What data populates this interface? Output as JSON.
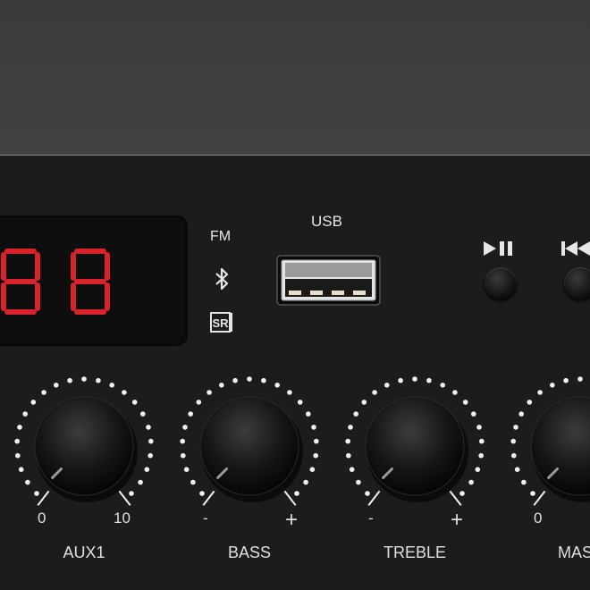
{
  "display": {
    "value": "88",
    "color": "#d8232a"
  },
  "modes": {
    "fm": "FM",
    "bluetooth_icon": "bluetooth-icon",
    "sr_icon": "sr-icon",
    "sr_text": "SR"
  },
  "usb": {
    "label": "USB"
  },
  "transport": {
    "play_pause_icon": "play-pause-icon",
    "previous_icon": "previous-icon"
  },
  "knobs": [
    {
      "name": "AUX1",
      "min": "0",
      "max": "10"
    },
    {
      "name": "BASS",
      "min": "-",
      "max": "+"
    },
    {
      "name": "TREBLE",
      "min": "-",
      "max": "+"
    },
    {
      "name": "MAST",
      "min": "0",
      "max": ""
    }
  ],
  "colors": {
    "panel": "#1c1c1c",
    "background": "#3e3e3e",
    "led": "#d8232a",
    "text": "#e0e0e0"
  }
}
